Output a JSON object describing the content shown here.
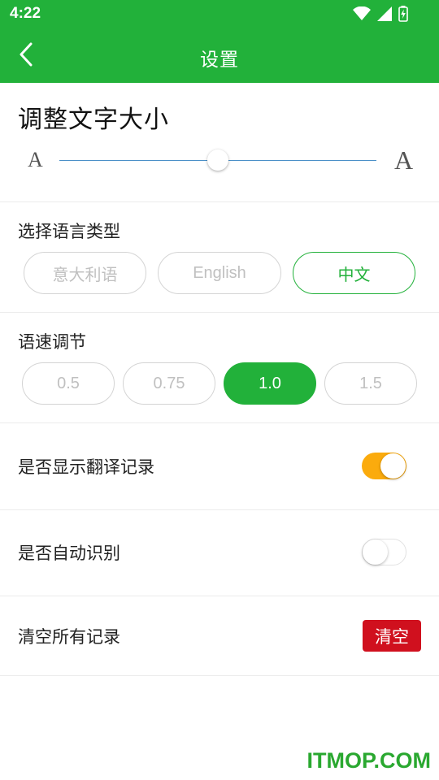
{
  "status_bar": {
    "time": "4:22",
    "icons": [
      "wifi-icon",
      "signal-icon",
      "battery-charging-icon"
    ]
  },
  "app_bar": {
    "title": "设置",
    "back_icon": "chevron-left-icon"
  },
  "font_size": {
    "title": "调整文字大小",
    "small_label": "A",
    "large_label": "A",
    "slider_value": 0.5
  },
  "language": {
    "label": "选择语言类型",
    "options": [
      "意大利语",
      "English",
      "中文"
    ],
    "selected": "中文"
  },
  "speed": {
    "label": "语速调节",
    "options": [
      "0.5",
      "0.75",
      "1.0",
      "1.5"
    ],
    "selected": "1.0"
  },
  "show_history": {
    "label": "是否显示翻译记录",
    "enabled": true
  },
  "auto_detect": {
    "label": "是否自动识别",
    "enabled": false
  },
  "clear_records": {
    "label": "清空所有记录",
    "button": "清空"
  },
  "watermark": "ITMOP.COM",
  "colors": {
    "primary": "#22b13a",
    "toggle_on": "#fbab0d",
    "danger": "#d0101e"
  }
}
